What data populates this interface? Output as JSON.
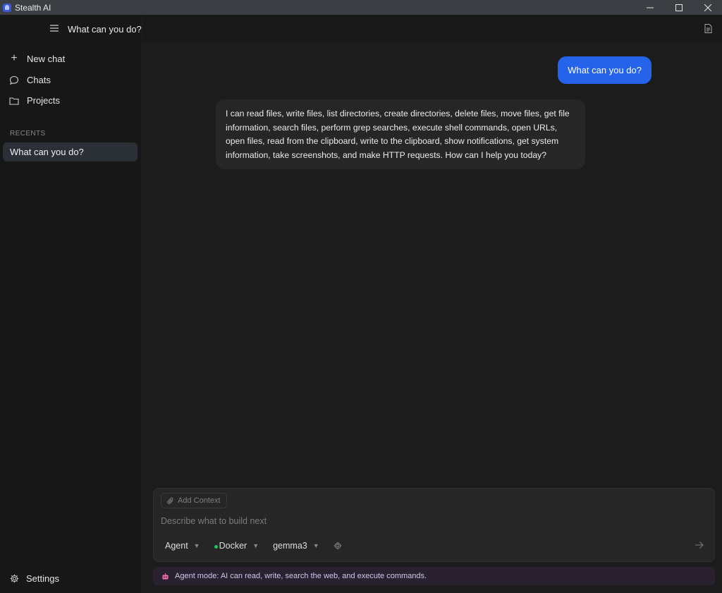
{
  "window": {
    "title": "Stealth AI"
  },
  "header": {
    "title": "What can you do?"
  },
  "sidebar": {
    "new_chat": "New chat",
    "chats": "Chats",
    "projects": "Projects",
    "recents_label": "RECENTS",
    "recents": [
      "What can you do?"
    ],
    "settings": "Settings"
  },
  "messages": {
    "user": "What can you do?",
    "assistant": "I can read files, write files, list directories, create directories, delete files, move files, get file information, search files, perform grep searches, execute shell commands, open URLs, open files, read from the clipboard, write to the clipboard, show notifications, get system information, take screenshots, and make HTTP requests.  How can I help you today?"
  },
  "composer": {
    "add_context": "Add Context",
    "placeholder": "Describe what to build next",
    "mode": "Agent",
    "environment": "Docker",
    "model": "gemma3"
  },
  "banner": {
    "text": "Agent mode: AI can read, write, search the web, and execute commands."
  },
  "colors": {
    "accent": "#2563eb",
    "status_ok": "#22c55e",
    "new_chat_plus": "#f07a3b"
  },
  "icons": [
    "app-icon",
    "minimize-icon",
    "maximize-icon",
    "close-icon",
    "menu-icon",
    "document-icon",
    "plus-icon",
    "chat-bubble-icon",
    "folder-icon",
    "gear-icon",
    "paperclip-icon",
    "chevron-down-icon",
    "send-arrow-icon",
    "robot-icon"
  ]
}
